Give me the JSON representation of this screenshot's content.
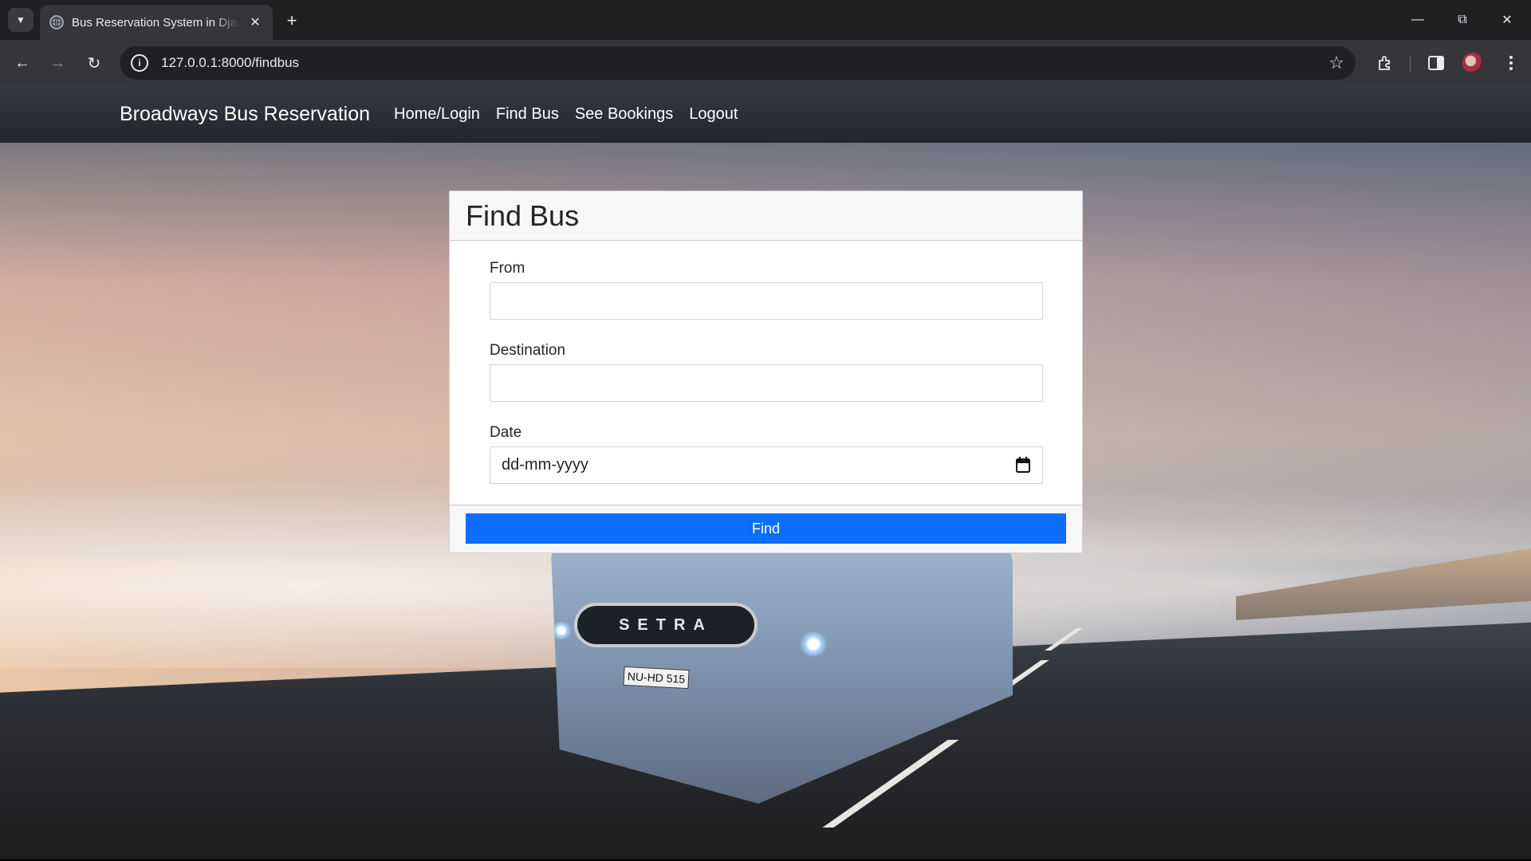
{
  "browser": {
    "tab": {
      "title": "Bus Reservation System in Djan"
    },
    "address_bar": {
      "url": "127.0.0.1:8000/findbus"
    }
  },
  "navbar": {
    "brand": "Broadways Bus Reservation",
    "links": [
      "Home/Login",
      "Find Bus",
      "See Bookings",
      "Logout"
    ]
  },
  "form": {
    "title": "Find Bus",
    "fields": {
      "from": {
        "label": "From",
        "value": ""
      },
      "destination": {
        "label": "Destination",
        "value": ""
      },
      "date": {
        "label": "Date",
        "placeholder": "dd-mm-yyyy"
      }
    },
    "submit_label": "Find"
  },
  "background": {
    "bus_brand": "SETRA",
    "plate": "NU-HD 515"
  },
  "colors": {
    "primary_button": "#0d6efd",
    "navbar": "#2b3035"
  }
}
